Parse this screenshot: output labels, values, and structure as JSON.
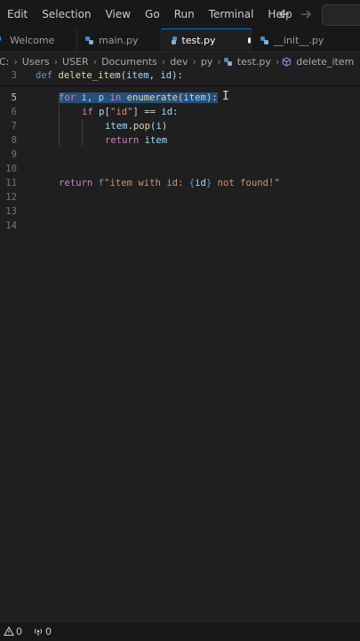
{
  "menubar": {
    "items": [
      "Edit",
      "Selection",
      "View",
      "Go",
      "Run",
      "Terminal",
      "Help"
    ]
  },
  "tabs": [
    {
      "label": "Welcome"
    },
    {
      "label": "main.py"
    },
    {
      "label": "test.py"
    },
    {
      "label": "__init__.py"
    }
  ],
  "breadcrumb": {
    "drive": "C:",
    "parts": [
      "Users",
      "USER",
      "Documents",
      "dev",
      "py"
    ],
    "file": "test.py",
    "symbol": "delete_item"
  },
  "editor": {
    "sticky_line": {
      "number": "3",
      "text": "def delete_item(item, id):"
    },
    "lines": [
      {
        "number": "5",
        "code": "for i, p in enumerate(item):"
      },
      {
        "number": "6",
        "code": "if p[\"id\"] == id:"
      },
      {
        "number": "7",
        "code": "item.pop(i)"
      },
      {
        "number": "8",
        "code": "return item"
      },
      {
        "number": "9",
        "code": ""
      },
      {
        "number": "10",
        "code": ""
      },
      {
        "number": "11",
        "code": "return f\"item with id: {id} not found!\""
      },
      {
        "number": "12",
        "code": ""
      },
      {
        "number": "13",
        "code": ""
      },
      {
        "number": "14",
        "code": ""
      }
    ],
    "cursor_line": "5"
  },
  "statusbar": {
    "errors": "0",
    "warnings": "0"
  },
  "colors": {
    "keyword": "#569cd6",
    "control": "#c586c0",
    "function": "#dcdcaa",
    "variable": "#9cdcfe",
    "string": "#ce9178",
    "selection": "#264f78"
  }
}
